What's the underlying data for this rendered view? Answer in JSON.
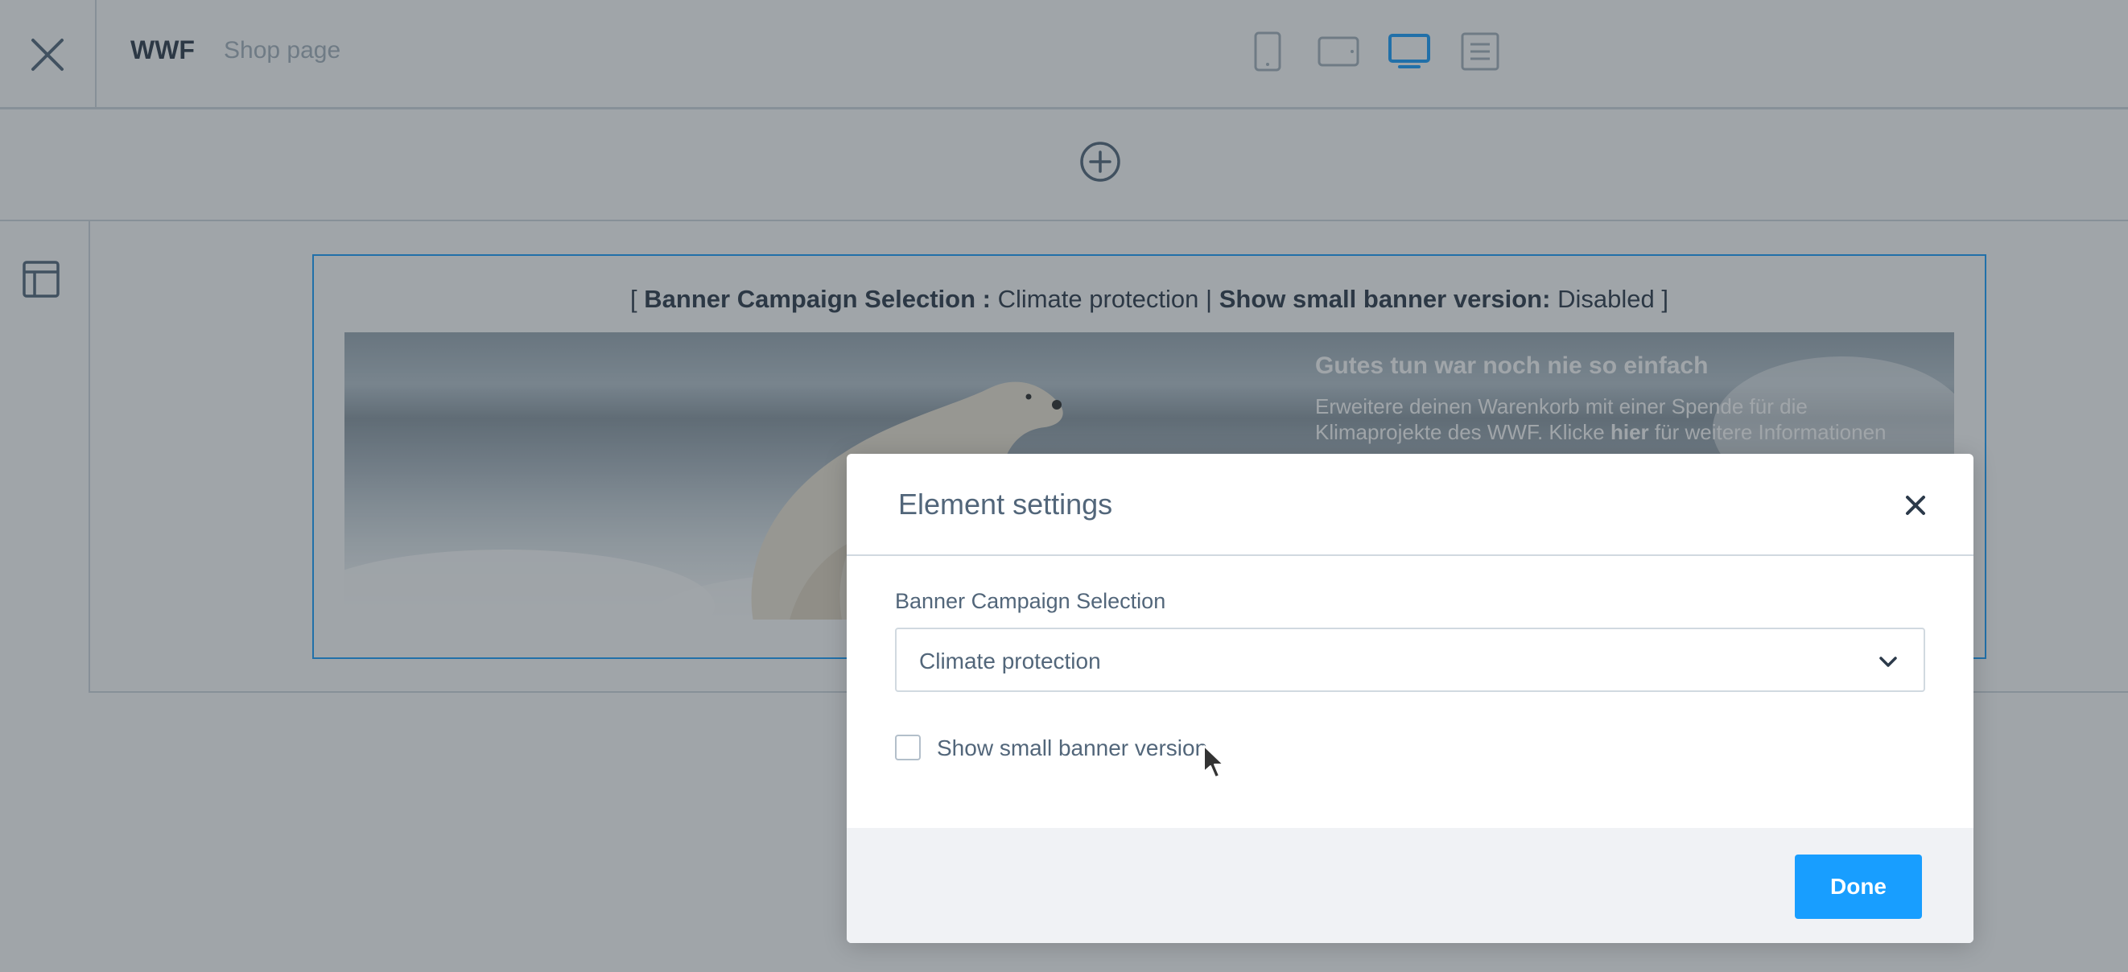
{
  "topbar": {
    "close_icon": "close-icon",
    "app_title": "WWF",
    "page_name": "Shop page",
    "devices": [
      {
        "name": "mobile",
        "icon": "mobile-icon",
        "active": false
      },
      {
        "name": "tablet",
        "icon": "tablet-landscape-icon",
        "active": false
      },
      {
        "name": "desktop",
        "icon": "desktop-icon",
        "active": true
      },
      {
        "name": "list",
        "icon": "list-view-icon",
        "active": false
      }
    ]
  },
  "add_bar": {
    "icon": "plus-circle-icon"
  },
  "sidebar": {
    "icon": "layout-icon"
  },
  "element": {
    "caption_open": "[",
    "campaign_label": "Banner Campaign Selection :",
    "campaign_value": "Climate protection",
    "separator": "|",
    "small_banner_label": "Show small banner version:",
    "small_banner_value": "Disabled",
    "caption_close": "]",
    "banner": {
      "headline": "Gutes tun war noch nie so einfach",
      "line1": "Erweitere deinen Warenkorb mit einer Spende für die",
      "line2_prefix": "Klimaprojekte des WWF. Klicke ",
      "line2_bold": "hier",
      "line2_suffix": " für weitere Informationen"
    }
  },
  "modal": {
    "title": "Element settings",
    "close_icon": "close-icon",
    "campaign_field": {
      "label": "Banner Campaign Selection",
      "value": "Climate protection",
      "icon": "chevron-down-icon"
    },
    "small_banner_checkbox": {
      "label": "Show small banner version",
      "checked": false
    },
    "done_label": "Done"
  },
  "colors": {
    "accent": "#189eff",
    "border": "#d1d9e0",
    "text": "#2c3a4a",
    "muted_text": "#52667a",
    "footer_bg": "#f0f2f5"
  }
}
